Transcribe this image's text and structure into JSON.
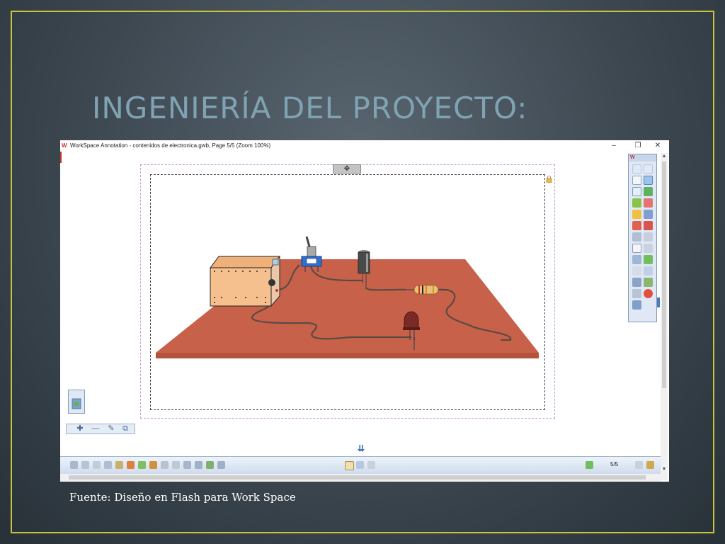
{
  "slide": {
    "title": "INGENIERÍA DEL PROYECTO:",
    "caption": "Fuente: Diseño en Flash para Work Space"
  },
  "window": {
    "app_logo": "W",
    "title": "WorkSpace Annotation - contenidos de electronica.gwb, Page 5/5 (Zoom 100%)",
    "minimize": "–",
    "restore": "❐",
    "close": "✕"
  },
  "canvas": {
    "drag_handle_glyph": "✥"
  },
  "floating_toolbar": {
    "logo": "W"
  },
  "mini_toolbar": {
    "buttons": [
      "✚",
      "—",
      "✎",
      "⧉"
    ]
  },
  "bottom_toolbar": {
    "expand_glyph": "⇊",
    "page_counter": "5/5"
  },
  "colors": {
    "frame": "#c9c23a",
    "title": "#7fa3b3",
    "board": "#c8614a",
    "board_edge": "#b4533c",
    "power_supply": "#f5c08e",
    "capacitor": "#555555",
    "resistor": "#e8c07a",
    "led": "#7a2a25",
    "switch_base": "#2f6fd0"
  }
}
